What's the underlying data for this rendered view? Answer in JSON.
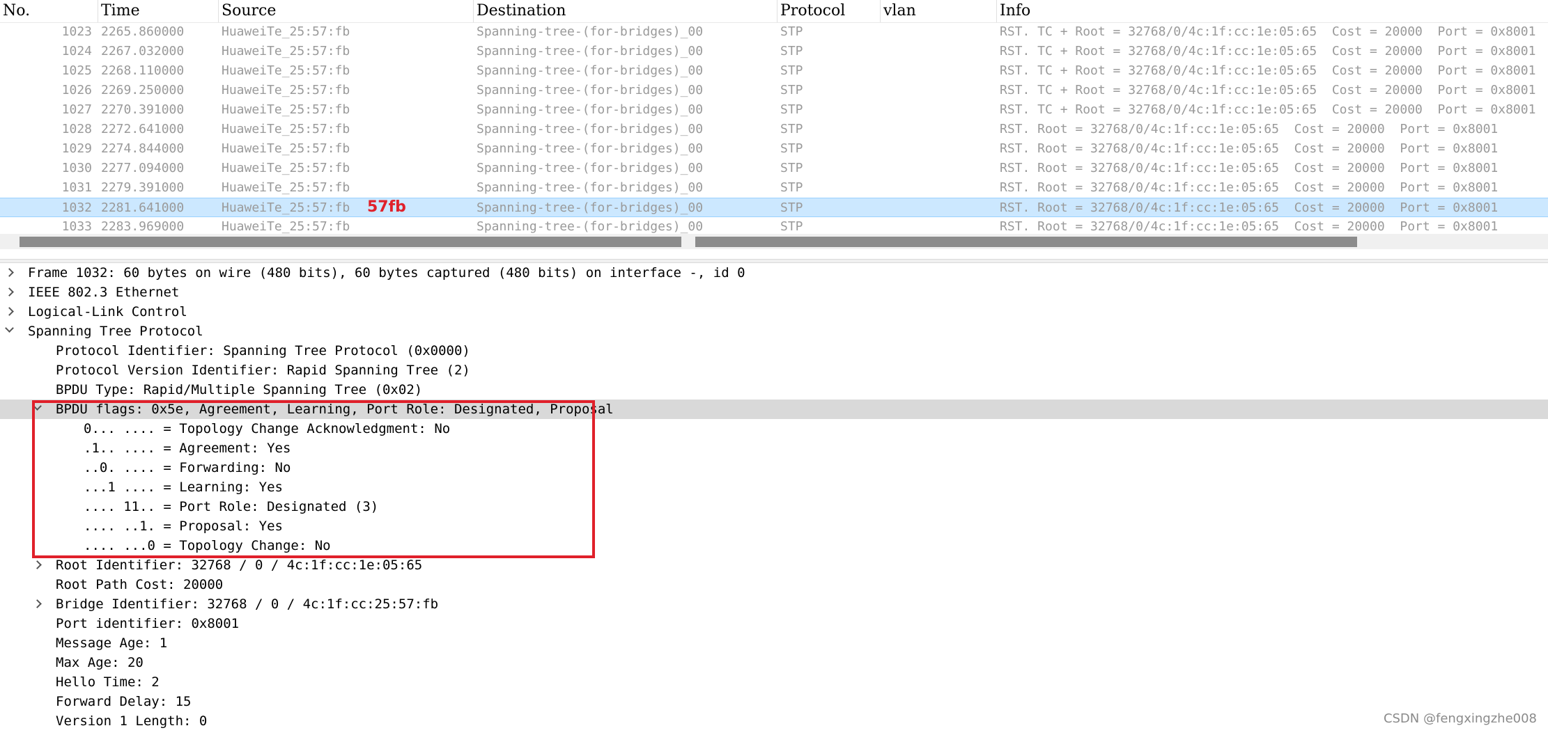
{
  "columns": [
    "No.",
    "Time",
    "Source",
    "Destination",
    "Protocol",
    "vlan",
    "Info"
  ],
  "packets": [
    {
      "no": "1023",
      "time": "2265.860000",
      "src": "HuaweiTe_25:57:fb",
      "dst": "Spanning-tree-(for-bridges)_00",
      "proto": "STP",
      "info": "RST. TC + Root = 32768/0/4c:1f:cc:1e:05:65  Cost = 20000  Port = 0x8001"
    },
    {
      "no": "1024",
      "time": "2267.032000",
      "src": "HuaweiTe_25:57:fb",
      "dst": "Spanning-tree-(for-bridges)_00",
      "proto": "STP",
      "info": "RST. TC + Root = 32768/0/4c:1f:cc:1e:05:65  Cost = 20000  Port = 0x8001"
    },
    {
      "no": "1025",
      "time": "2268.110000",
      "src": "HuaweiTe_25:57:fb",
      "dst": "Spanning-tree-(for-bridges)_00",
      "proto": "STP",
      "info": "RST. TC + Root = 32768/0/4c:1f:cc:1e:05:65  Cost = 20000  Port = 0x8001"
    },
    {
      "no": "1026",
      "time": "2269.250000",
      "src": "HuaweiTe_25:57:fb",
      "dst": "Spanning-tree-(for-bridges)_00",
      "proto": "STP",
      "info": "RST. TC + Root = 32768/0/4c:1f:cc:1e:05:65  Cost = 20000  Port = 0x8001"
    },
    {
      "no": "1027",
      "time": "2270.391000",
      "src": "HuaweiTe_25:57:fb",
      "dst": "Spanning-tree-(for-bridges)_00",
      "proto": "STP",
      "info": "RST. TC + Root = 32768/0/4c:1f:cc:1e:05:65  Cost = 20000  Port = 0x8001"
    },
    {
      "no": "1028",
      "time": "2272.641000",
      "src": "HuaweiTe_25:57:fb",
      "dst": "Spanning-tree-(for-bridges)_00",
      "proto": "STP",
      "info": "RST. Root = 32768/0/4c:1f:cc:1e:05:65  Cost = 20000  Port = 0x8001"
    },
    {
      "no": "1029",
      "time": "2274.844000",
      "src": "HuaweiTe_25:57:fb",
      "dst": "Spanning-tree-(for-bridges)_00",
      "proto": "STP",
      "info": "RST. Root = 32768/0/4c:1f:cc:1e:05:65  Cost = 20000  Port = 0x8001"
    },
    {
      "no": "1030",
      "time": "2277.094000",
      "src": "HuaweiTe_25:57:fb",
      "dst": "Spanning-tree-(for-bridges)_00",
      "proto": "STP",
      "info": "RST. Root = 32768/0/4c:1f:cc:1e:05:65  Cost = 20000  Port = 0x8001"
    },
    {
      "no": "1031",
      "time": "2279.391000",
      "src": "HuaweiTe_25:57:fb",
      "dst": "Spanning-tree-(for-bridges)_00",
      "proto": "STP",
      "info": "RST. Root = 32768/0/4c:1f:cc:1e:05:65  Cost = 20000  Port = 0x8001"
    },
    {
      "no": "1032",
      "time": "2281.641000",
      "src": "HuaweiTe_25:57:fb",
      "dst": "Spanning-tree-(for-bridges)_00",
      "proto": "STP",
      "info": "RST. Root = 32768/0/4c:1f:cc:1e:05:65  Cost = 20000  Port = 0x8001",
      "selected": true
    },
    {
      "no": "1033",
      "time": "2283.969000",
      "src": "HuaweiTe_25:57:fb",
      "dst": "Spanning-tree-(for-bridges)_00",
      "proto": "STP",
      "info": "RST. Root = 32768/0/4c:1f:cc:1e:05:65  Cost = 20000  Port = 0x8001"
    }
  ],
  "annotation": "57fb",
  "details": [
    {
      "text": "Frame 1032: 60 bytes on wire (480 bits), 60 bytes captured (480 bits) on interface -, id 0",
      "level": 0,
      "expander": "collapsed"
    },
    {
      "text": "IEEE 802.3 Ethernet",
      "level": 0,
      "expander": "collapsed"
    },
    {
      "text": "Logical-Link Control",
      "level": 0,
      "expander": "collapsed"
    },
    {
      "text": "Spanning Tree Protocol",
      "level": 0,
      "expander": "expanded"
    },
    {
      "text": "Protocol Identifier: Spanning Tree Protocol (0x0000)",
      "level": 1,
      "expander": "none"
    },
    {
      "text": "Protocol Version Identifier: Rapid Spanning Tree (2)",
      "level": 1,
      "expander": "none"
    },
    {
      "text": "BPDU Type: Rapid/Multiple Spanning Tree (0x02)",
      "level": 1,
      "expander": "none"
    },
    {
      "text": "BPDU flags: 0x5e, Agreement, Learning, Port Role: Designated, Proposal",
      "level": 1,
      "expander": "expanded",
      "highlighted": true
    },
    {
      "text": "0... .... = Topology Change Acknowledgment: No",
      "level": 2,
      "expander": "none"
    },
    {
      "text": ".1.. .... = Agreement: Yes",
      "level": 2,
      "expander": "none"
    },
    {
      "text": "..0. .... = Forwarding: No",
      "level": 2,
      "expander": "none"
    },
    {
      "text": "...1 .... = Learning: Yes",
      "level": 2,
      "expander": "none"
    },
    {
      "text": ".... 11.. = Port Role: Designated (3)",
      "level": 2,
      "expander": "none"
    },
    {
      "text": ".... ..1. = Proposal: Yes",
      "level": 2,
      "expander": "none"
    },
    {
      "text": ".... ...0 = Topology Change: No",
      "level": 2,
      "expander": "none"
    },
    {
      "text": "Root Identifier: 32768 / 0 / 4c:1f:cc:1e:05:65",
      "level": 1,
      "expander": "collapsed"
    },
    {
      "text": "Root Path Cost: 20000",
      "level": 1,
      "expander": "none"
    },
    {
      "text": "Bridge Identifier: 32768 / 0 / 4c:1f:cc:25:57:fb",
      "level": 1,
      "expander": "collapsed"
    },
    {
      "text": "Port identifier: 0x8001",
      "level": 1,
      "expander": "none"
    },
    {
      "text": "Message Age: 1",
      "level": 1,
      "expander": "none"
    },
    {
      "text": "Max Age: 20",
      "level": 1,
      "expander": "none"
    },
    {
      "text": "Hello Time: 2",
      "level": 1,
      "expander": "none"
    },
    {
      "text": "Forward Delay: 15",
      "level": 1,
      "expander": "none"
    },
    {
      "text": "Version 1 Length: 0",
      "level": 1,
      "expander": "none"
    }
  ],
  "watermark": "CSDN @fengxingzhe008",
  "colors": {
    "selection": "#cce8ff",
    "annotation": "#e0202a",
    "highlight_row": "#d9d9d9"
  }
}
